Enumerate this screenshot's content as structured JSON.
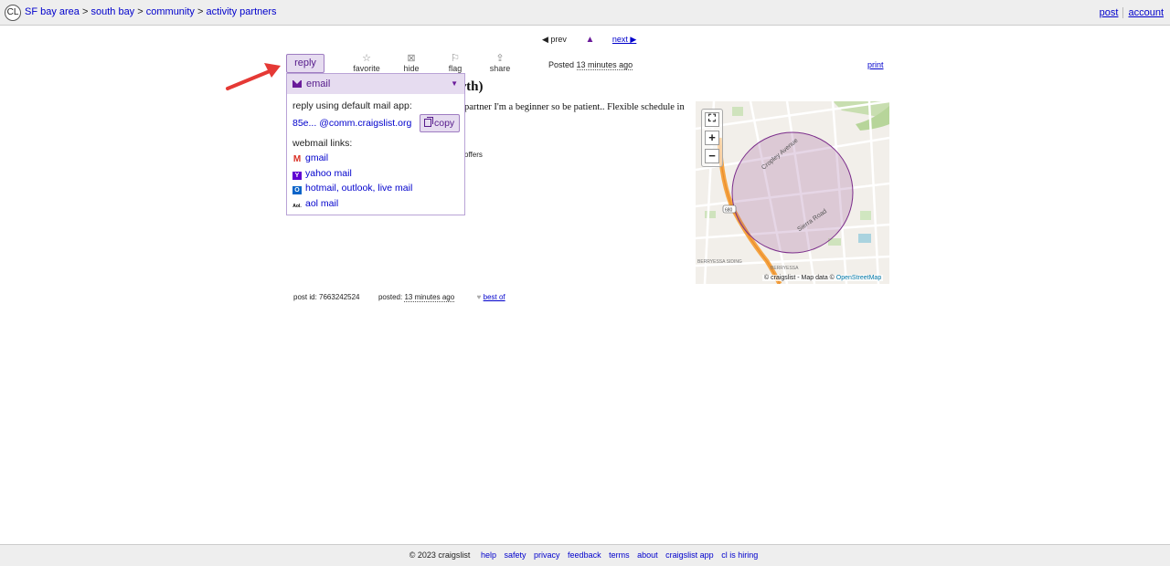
{
  "header": {
    "logo": "CL",
    "breadcrumbs": [
      "SF bay area",
      "south bay",
      "community",
      "activity partners"
    ],
    "separator": ">",
    "links": [
      "post",
      "account"
    ]
  },
  "nav": {
    "prev": "◀ prev",
    "up": "▲",
    "next": "next ▶"
  },
  "actions": {
    "reply": "reply",
    "favorite": "favorite",
    "hide": "hide",
    "flag": "flag",
    "share": "share",
    "posted_label": "Posted",
    "posted_time": "13 minutes ago",
    "print": "print"
  },
  "post": {
    "title_fragment": "orth)",
    "body_fragment": "partner I'm a beginner so be patient.. Flexible schedule in",
    "attr_fragment": "offers"
  },
  "reply_panel": {
    "method": "email",
    "default_app_label": "reply using default mail app:",
    "email": "85e... @comm.craigslist.org",
    "copy": "copy",
    "webmail_label": "webmail links:",
    "webmail": [
      "gmail",
      "yahoo mail",
      "hotmail, outlook, live mail",
      "aol mail"
    ]
  },
  "map": {
    "street1": "Cropley Avenue",
    "street2": "Sierra Road",
    "highway": "680",
    "place1": "BERRYESSA SIDING",
    "place2": "BERRYESSA",
    "credit_prefix": "© craigslist - Map data ©",
    "credit_link": "OpenStreetMap",
    "zoom_in": "+",
    "zoom_out": "−",
    "fullscreen": "⛶"
  },
  "postinfo": {
    "post_id": "post id: 7663242524",
    "posted_label": "posted:",
    "posted_time": "13 minutes ago",
    "best_of": "best of"
  },
  "footer": {
    "copyright": "© 2023 craigslist",
    "links": [
      "help",
      "safety",
      "privacy",
      "feedback",
      "terms",
      "about",
      "craigslist app",
      "cl is hiring"
    ]
  },
  "colors": {
    "accent_purple": "#551a8b",
    "button_bg": "#e6dcf0",
    "link_blue": "#0000cc",
    "arrow_red": "#e53935"
  }
}
